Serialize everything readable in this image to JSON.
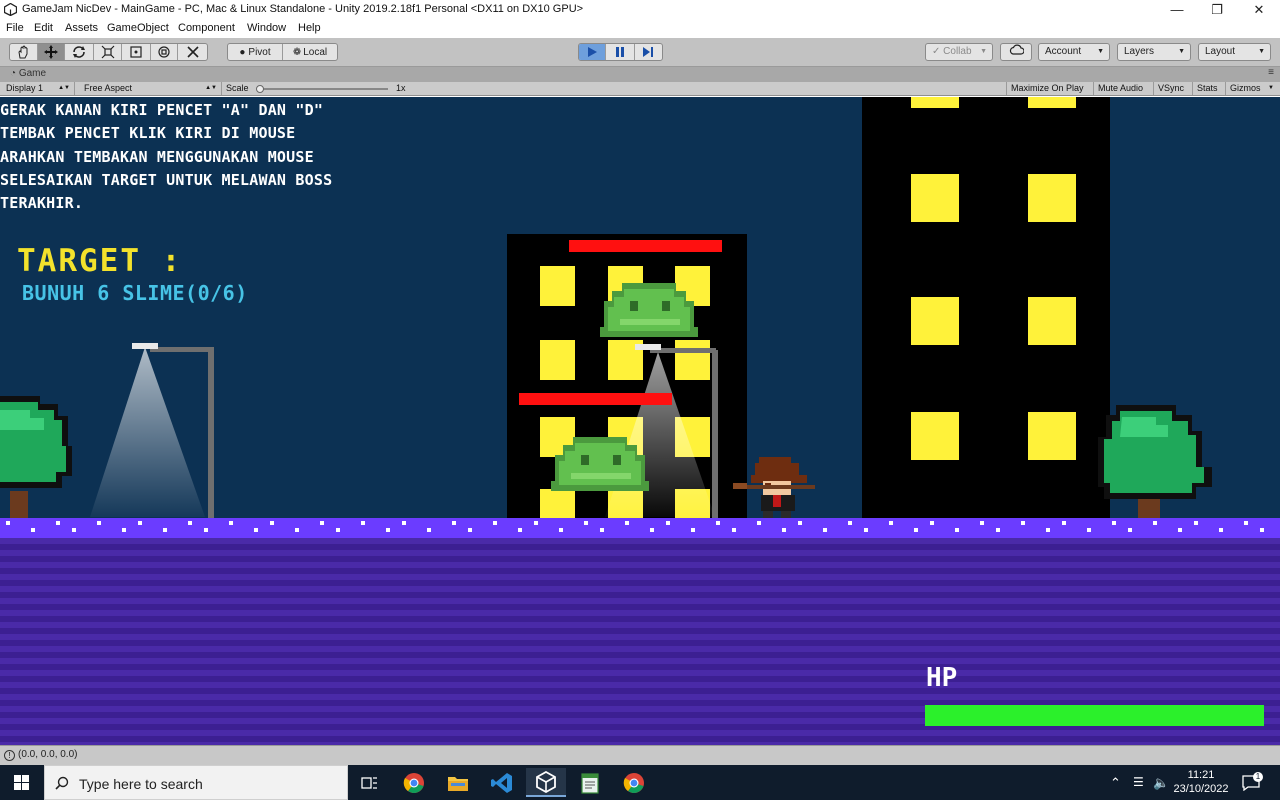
{
  "window": {
    "title": "GameJam NicDev - MainGame - PC, Mac & Linux Standalone - Unity 2019.2.18f1 Personal <DX11 on DX10 GPU>",
    "minimize_icon": "minimize-icon",
    "restore_icon": "restore-icon",
    "close_icon": "close-icon"
  },
  "menu": [
    "File",
    "Edit",
    "Assets",
    "GameObject",
    "Component",
    "Window",
    "Help"
  ],
  "toolbar": {
    "tools": [
      "hand-tool-icon",
      "move-tool-icon",
      "rotate-tool-icon",
      "scale-tool-icon",
      "rect-tool-icon",
      "transform-tool-icon",
      "custom-tool-icon"
    ],
    "active_tool": "move-tool-icon",
    "pivot_label": "Pivot",
    "local_label": "Local",
    "collab_label": "Collab",
    "account_label": "Account",
    "layers_label": "Layers",
    "layout_label": "Layout"
  },
  "game_tab": {
    "label": "Game",
    "display": "Display 1",
    "aspect": "Free Aspect",
    "scale_label": "Scale",
    "scale_value": "1x",
    "maximize": "Maximize On Play",
    "mute": "Mute Audio",
    "vsync": "VSync",
    "stats": "Stats",
    "gizmos": "Gizmos"
  },
  "game": {
    "instructions": [
      "GERAK KANAN KIRI PENCET \"A\" DAN \"D\"",
      "TEMBAK PENCET KLIK KIRI DI MOUSE",
      "ARAHKAN TEMBAKAN MENGGUNAKAN MOUSE",
      "SELESAIKAN TARGET UNTUK MELAWAN BOSS",
      "TERAKHIR."
    ],
    "target_title": "TARGET :",
    "target_desc": "BUNUH 6 SLIME(0/6)",
    "hp_label": "HP",
    "hp_fraction": 1.0,
    "enemies": [
      {
        "name": "slime-top",
        "hp_fraction": 1.0
      },
      {
        "name": "slime-bottom",
        "hp_fraction": 1.0
      }
    ],
    "colors": {
      "sky": "#0c3153",
      "window": "#fff23a",
      "ground": "#6b3cff",
      "hp": "#2bf02b",
      "enemy_hp": "#ff1010",
      "slime": "#5cb648",
      "tree": "#1fa85a"
    }
  },
  "status": {
    "text": "(0.0, 0.0, 0.0)"
  },
  "taskbar": {
    "search_placeholder": "Type here to search",
    "apps": [
      "task-view-icon",
      "chrome-icon",
      "file-explorer-icon",
      "visual-studio-icon",
      "unity-icon",
      "notepad-icon",
      "chrome-icon"
    ],
    "active_app": "unity-icon",
    "time": "11:21",
    "date": "23/10/2022",
    "notification_count": "1"
  }
}
